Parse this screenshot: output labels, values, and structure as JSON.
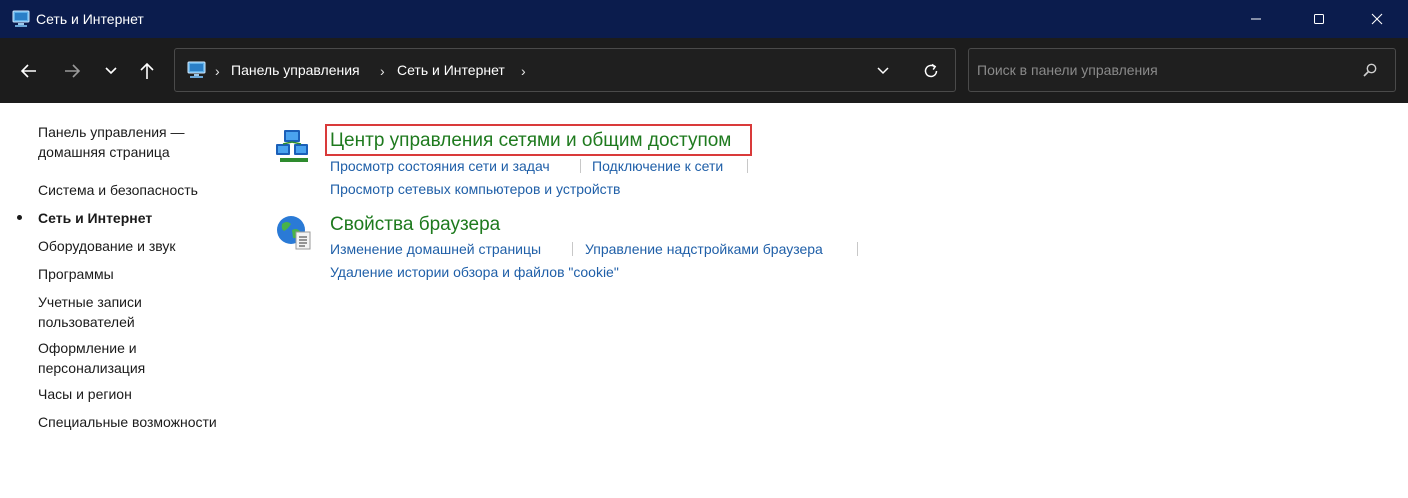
{
  "window": {
    "title": "Сеть и Интернет",
    "icon": "control-panel-icon"
  },
  "address": {
    "crumbs": [
      "Панель управления",
      "Сеть и Интернет"
    ]
  },
  "search": {
    "placeholder": "Поиск в панели управления"
  },
  "sidebar": {
    "items": [
      {
        "label": "Панель управления —\nдомашняя страница",
        "active": false
      },
      {
        "label": "Система и безопасность",
        "active": false
      },
      {
        "label": "Сеть и Интернет",
        "active": true
      },
      {
        "label": "Оборудование и звук",
        "active": false
      },
      {
        "label": "Программы",
        "active": false
      },
      {
        "label": "Учетные записи\nпользователей",
        "active": false
      },
      {
        "label": "Оформление и\nперсонализация",
        "active": false
      },
      {
        "label": "Часы и регион",
        "active": false
      },
      {
        "label": "Специальные возможности",
        "active": false
      }
    ]
  },
  "categories": [
    {
      "title": "Центр управления сетями и общим доступом",
      "icon": "network-center-icon",
      "highlighted": true,
      "links": [
        "Просмотр состояния сети и задач",
        "Подключение к сети",
        "Просмотр сетевых компьютеров и устройств"
      ]
    },
    {
      "title": "Свойства браузера",
      "icon": "internet-options-icon",
      "highlighted": false,
      "links": [
        "Изменение домашней страницы",
        "Управление надстройками браузера",
        "Удаление истории обзора и файлов \"cookie\""
      ]
    }
  ],
  "colors": {
    "titlebar": "#0b1c4d",
    "navbar": "#1c1c1c",
    "category_title": "#1e7a1e",
    "task_link": "#1f5fa8",
    "highlight_border": "#d93a3a"
  }
}
